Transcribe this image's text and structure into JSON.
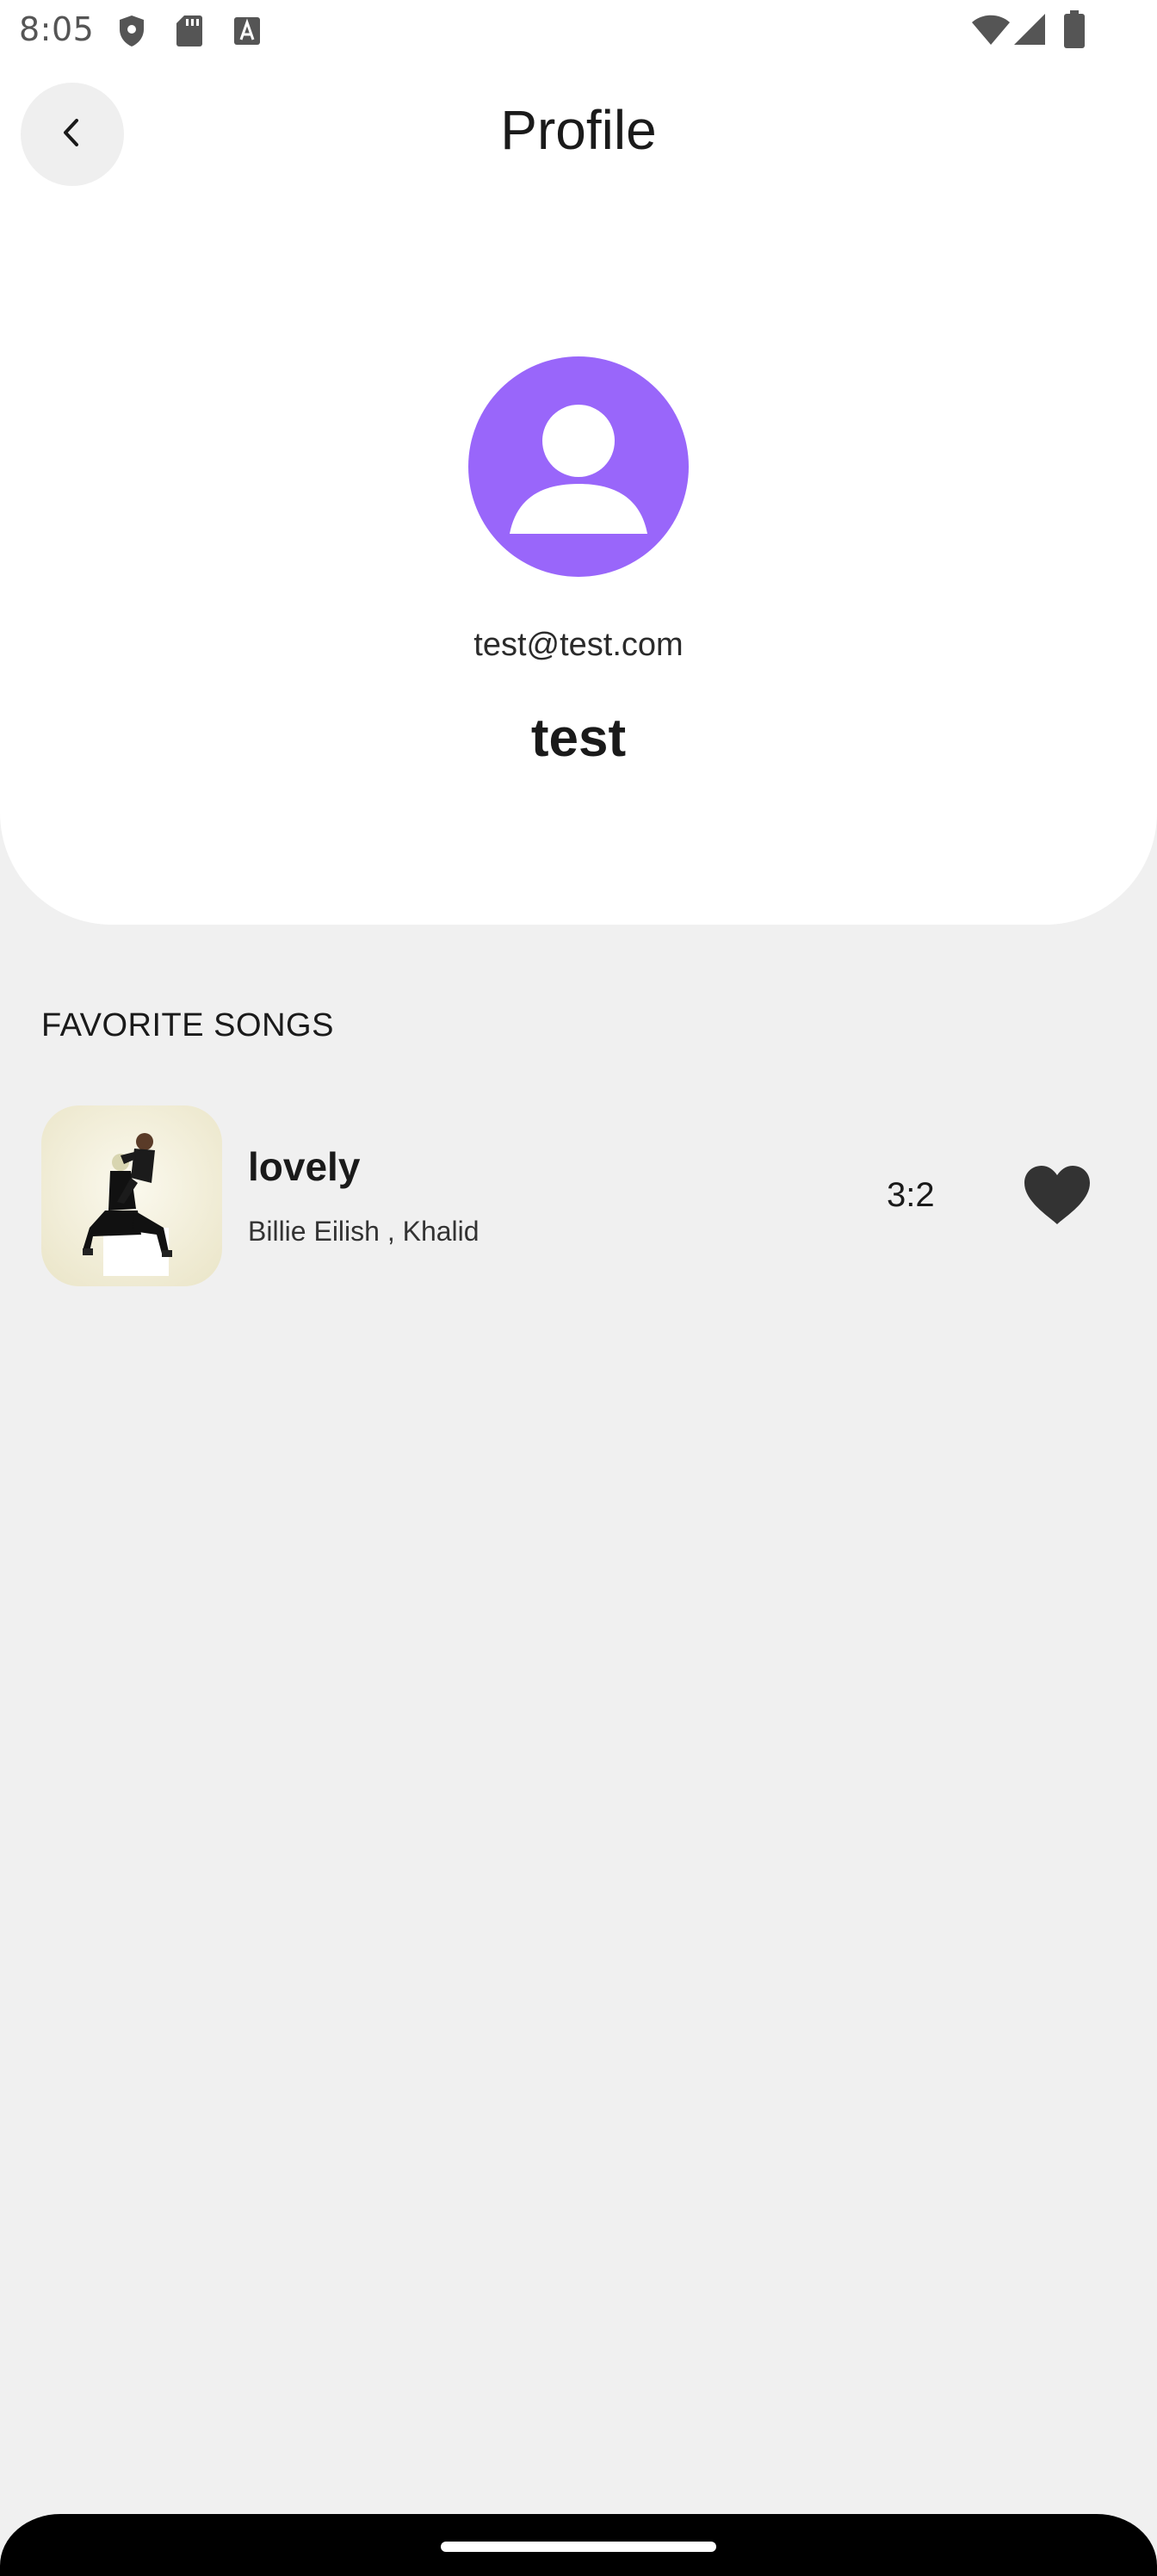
{
  "status_bar": {
    "time": "8:05",
    "icons": [
      "shield-icon",
      "sd-card-icon",
      "font-icon",
      "wifi-icon",
      "signal-icon",
      "battery-icon"
    ]
  },
  "header": {
    "title": "Profile",
    "back_icon": "chevron-left-icon"
  },
  "profile": {
    "email": "test@test.com",
    "name": "test",
    "avatar_color": "#9966fa",
    "avatar_icon": "person-icon"
  },
  "favorites": {
    "section_title": "FAVORITE SONGS",
    "songs": [
      {
        "title": "lovely",
        "artist": "Billie Eilish , Khalid",
        "duration": "3:2",
        "favorite": true,
        "art_icon": "album-art"
      }
    ]
  },
  "colors": {
    "background": "#f0f0f0",
    "card": "#ffffff",
    "text": "#1a1a1a",
    "accent": "#9966fa"
  }
}
